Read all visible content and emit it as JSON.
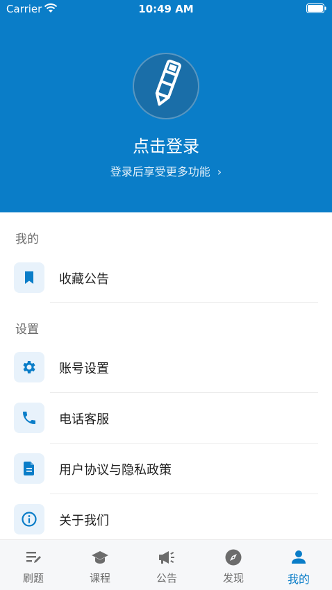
{
  "status_bar": {
    "carrier": "Carrier",
    "time": "10:49 AM"
  },
  "header": {
    "login_title": "点击登录",
    "login_subtitle": "登录后享受更多功能",
    "chevron": "›"
  },
  "sections": {
    "mine": {
      "title": "我的",
      "items": [
        {
          "label": "收藏公告",
          "icon": "bookmark-icon"
        }
      ]
    },
    "settings": {
      "title": "设置",
      "items": [
        {
          "label": "账号设置",
          "icon": "gear-icon"
        },
        {
          "label": "电话客服",
          "icon": "phone-icon"
        },
        {
          "label": "用户协议与隐私政策",
          "icon": "document-icon"
        },
        {
          "label": "关于我们",
          "icon": "info-icon"
        }
      ]
    }
  },
  "tabbar": {
    "tabs": [
      {
        "label": "刷题",
        "icon": "edit-list-icon"
      },
      {
        "label": "课程",
        "icon": "graduation-cap-icon"
      },
      {
        "label": "公告",
        "icon": "megaphone-icon"
      },
      {
        "label": "发现",
        "icon": "compass-icon"
      },
      {
        "label": "我的",
        "icon": "person-icon",
        "active": true
      }
    ]
  },
  "colors": {
    "primary": "#0a7dc8",
    "icon_bg": "#e8f2fb",
    "inactive": "#6c6c6c"
  }
}
